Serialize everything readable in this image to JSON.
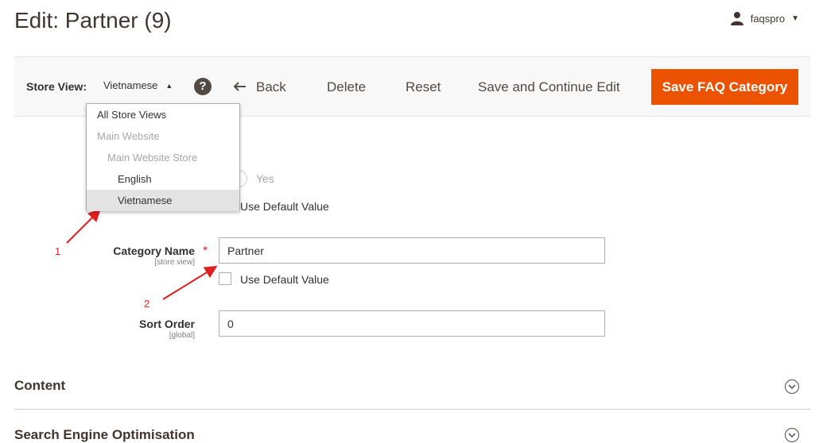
{
  "header": {
    "title": "Edit: Partner (9)",
    "user": "faqspro",
    "user_icon": "user-icon"
  },
  "toolbar": {
    "store_view_label": "Store View:",
    "store_view_value": "Vietnamese",
    "help_icon_text": "?",
    "back_label": "Back",
    "delete_label": "Delete",
    "reset_label": "Reset",
    "save_continue_label": "Save and Continue Edit",
    "save_label": "Save FAQ Category"
  },
  "store_dropdown": {
    "items": [
      "All Store Views",
      "Main Website",
      "Main Website Store",
      "English",
      "Vietnamese"
    ]
  },
  "form": {
    "enable_option": "Yes",
    "use_default_1": "Use Default Value",
    "category_name": {
      "label": "Category Name",
      "scope": "[store view]",
      "value": "Partner",
      "required_mark": "*"
    },
    "use_default_2": "Use Default Value",
    "sort_order": {
      "label": "Sort Order",
      "scope": "[global]",
      "value": "0"
    }
  },
  "sections": [
    "Content",
    "Search Engine Optimisation"
  ],
  "annotations": [
    "1",
    "2"
  ],
  "colors": {
    "accent": "#eb5202",
    "annotation": "#e02020",
    "toolbar_bg": "#f8f8f8",
    "dropdown_highlight": "#e3e3e3"
  }
}
